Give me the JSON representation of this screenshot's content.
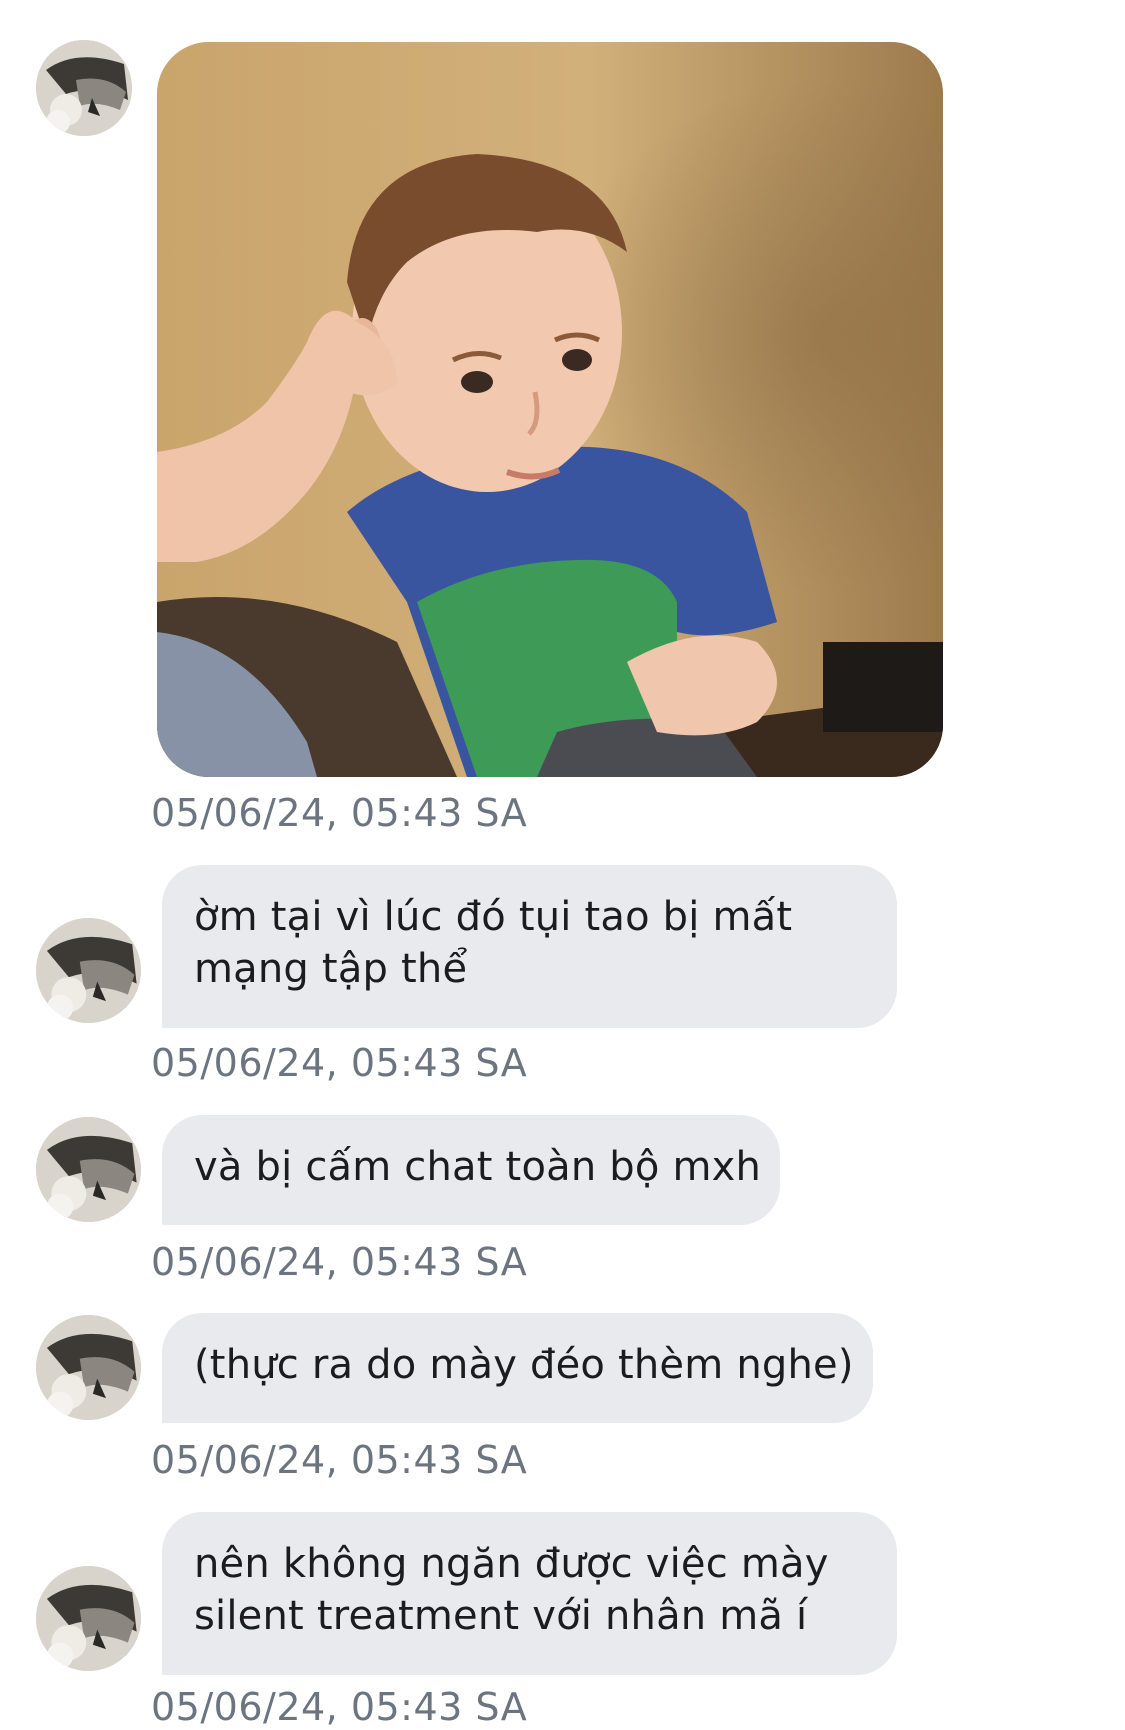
{
  "conversation": {
    "messages": [
      {
        "type": "image",
        "image_subject": "meme photo of a young boy in a blue and green t-shirt sitting on a couch with hand on his head",
        "timestamp": "05/06/24, 05:43 SA"
      },
      {
        "type": "text",
        "lines": [
          "ờm tại vì lúc đó tụi tao bị mất",
          "mạng tập thể"
        ],
        "timestamp": "05/06/24, 05:43 SA"
      },
      {
        "type": "text",
        "lines": [
          "và bị cấm chat toàn bộ mxh"
        ],
        "timestamp": "05/06/24, 05:43 SA"
      },
      {
        "type": "text",
        "lines": [
          "(thực ra do mày đéo thèm nghe)"
        ],
        "timestamp": "05/06/24, 05:43 SA"
      },
      {
        "type": "text",
        "lines": [
          "nên không ngăn được việc mày",
          "silent treatment với nhân mã í"
        ],
        "timestamp": "05/06/24, 05:43 SA"
      }
    ]
  },
  "colors": {
    "background": "#ffffff",
    "bubble": "#e9eaee",
    "message_text": "#1c1c1e",
    "timestamp_text": "#6c7480"
  },
  "icons": {
    "avatar": "sender-avatar-icon"
  }
}
